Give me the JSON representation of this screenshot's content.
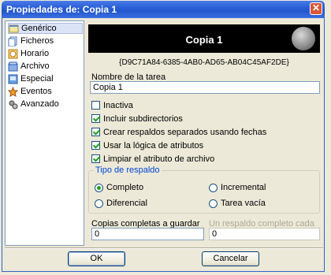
{
  "window": {
    "title": "Propiedades de: Copia 1",
    "close_symbol": "✕"
  },
  "sidebar": {
    "items": [
      {
        "label": "Genérico",
        "icon": "task-icon",
        "selected": true
      },
      {
        "label": "Ficheros",
        "icon": "files-icon",
        "selected": false
      },
      {
        "label": "Horario",
        "icon": "clock-icon",
        "selected": false
      },
      {
        "label": "Archivo",
        "icon": "archive-icon",
        "selected": false
      },
      {
        "label": "Especial",
        "icon": "special-icon",
        "selected": false
      },
      {
        "label": "Eventos",
        "icon": "events-icon",
        "selected": false
      },
      {
        "label": "Avanzado",
        "icon": "advanced-icon",
        "selected": false
      }
    ]
  },
  "header": {
    "title": "Copia 1",
    "guid": "{D9C71A84-6385-4AB0-AD65-AB04C45AF2DE}"
  },
  "form": {
    "task_name_label": "Nombre de la tarea",
    "task_name_value": "Copia 1",
    "checkboxes": [
      {
        "label": "Inactiva",
        "checked": false
      },
      {
        "label": "Incluir subdirectorios",
        "checked": true
      },
      {
        "label": "Crear respaldos separados usando fechas",
        "checked": true
      },
      {
        "label": "Usar la lógica de atributos",
        "checked": true
      },
      {
        "label": "Limpiar el atributo de archivo",
        "checked": true
      }
    ],
    "backup_type": {
      "label": "Tipo de respaldo",
      "options": [
        {
          "label": "Completo",
          "selected": true
        },
        {
          "label": "Incremental",
          "selected": false
        },
        {
          "label": "Diferencial",
          "selected": false
        },
        {
          "label": "Tarea vacía",
          "selected": false
        }
      ]
    },
    "full_copies_label": "Copias completas a guardar",
    "full_copies_value": "0",
    "full_every_label": "Un respaldo completo cada",
    "full_every_value": "0"
  },
  "buttons": {
    "ok": "OK",
    "cancel": "Cancelar"
  },
  "colors": {
    "titlebar": "#2457cd",
    "accent": "#0046d5",
    "check": "#21a121"
  }
}
